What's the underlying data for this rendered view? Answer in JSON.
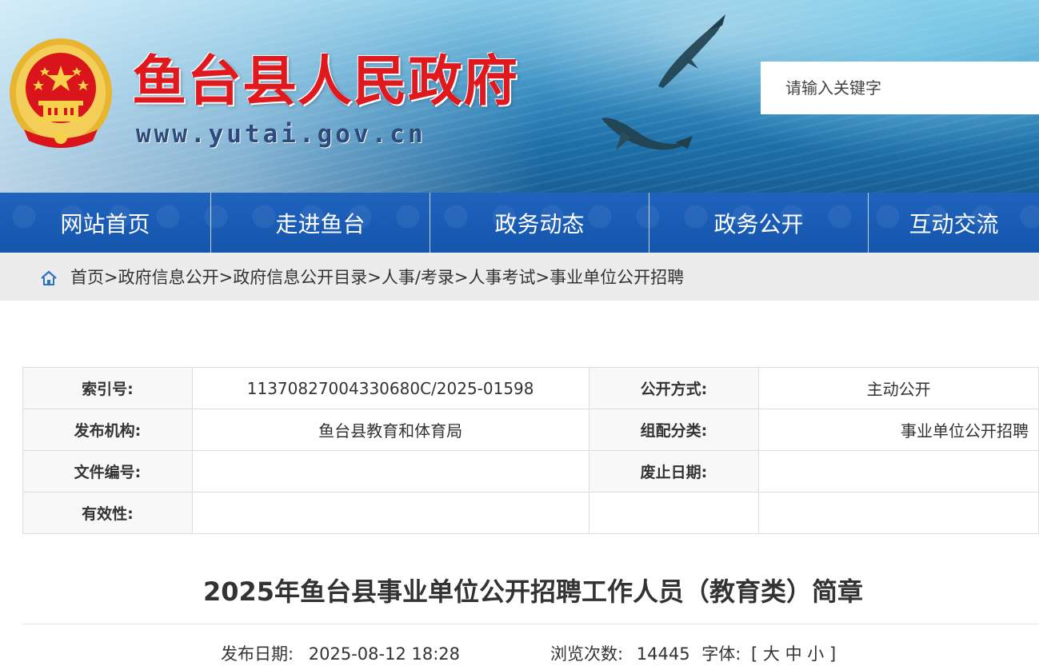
{
  "header": {
    "site_title": "鱼台县人民政府",
    "site_url": "www.yutai.gov.cn",
    "search_placeholder": "请输入关键字"
  },
  "nav": {
    "items": [
      {
        "label": "网站首页"
      },
      {
        "label": "走进鱼台"
      },
      {
        "label": "政务动态"
      },
      {
        "label": "政务公开"
      },
      {
        "label": "互动交流"
      }
    ]
  },
  "breadcrumb": {
    "items": [
      "首页",
      "政府信息公开",
      "政府信息公开目录",
      "人事/考录",
      "人事考试",
      "事业单位公开招聘"
    ],
    "separator": ">"
  },
  "meta": {
    "index_no_label": "索引号:",
    "index_no": "11370827004330680C/2025-01598",
    "disclosure_label": "公开方式:",
    "disclosure": "主动公开",
    "publisher_label": "发布机构:",
    "publisher": "鱼台县教育和体育局",
    "category_label": "组配分类:",
    "category": "事业单位公开招聘",
    "doc_no_label": "文件编号:",
    "doc_no": "",
    "expiry_label": "废止日期:",
    "expiry": "",
    "validity_label": "有效性:",
    "validity": ""
  },
  "article": {
    "title": "2025年鱼台县事业单位公开招聘工作人员（教育类）简章",
    "publish_label": "发布日期:",
    "publish_date": "2025-08-12 18:28",
    "views_label": "浏览次数:",
    "views": "14445",
    "font_label": "字体:",
    "font_open": "[",
    "font_large": "大",
    "font_medium": "中",
    "font_small": "小",
    "font_close": "]"
  },
  "colors": {
    "title_red": "#e0191e",
    "nav_blue": "#1a5cb5",
    "crumb_bg": "#ececec"
  }
}
